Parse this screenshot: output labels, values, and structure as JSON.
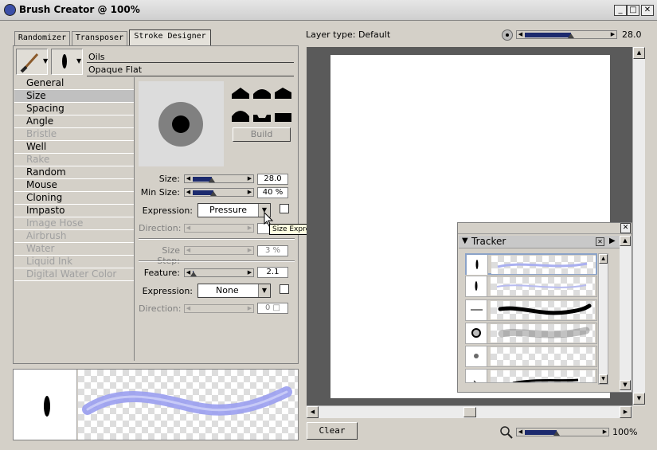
{
  "window": {
    "title": "Brush Creator @ 100%",
    "min": "_",
    "max": "□",
    "close": "✕"
  },
  "tabs": [
    {
      "label": "Randomizer"
    },
    {
      "label": "Transposer"
    },
    {
      "label": "Stroke Designer"
    }
  ],
  "brush": {
    "category": "Oils",
    "variant": "Opaque Flat"
  },
  "menu": [
    {
      "label": "General",
      "disabled": false
    },
    {
      "label": "Size",
      "disabled": false,
      "selected": true
    },
    {
      "label": "Spacing",
      "disabled": false
    },
    {
      "label": "Angle",
      "disabled": false
    },
    {
      "label": "Bristle",
      "disabled": true
    },
    {
      "label": "Well",
      "disabled": false
    },
    {
      "label": "Rake",
      "disabled": true
    },
    {
      "label": "Random",
      "disabled": false
    },
    {
      "label": "Mouse",
      "disabled": false
    },
    {
      "label": "Cloning",
      "disabled": false
    },
    {
      "label": "Impasto",
      "disabled": false
    },
    {
      "label": "Image Hose",
      "disabled": true
    },
    {
      "label": "Airbrush",
      "disabled": true
    },
    {
      "label": "Water",
      "disabled": true
    },
    {
      "label": "Liquid Ink",
      "disabled": true
    },
    {
      "label": "Digital Water Color",
      "disabled": true
    }
  ],
  "size_panel": {
    "build_label": "Build",
    "size_label": "Size:",
    "size_value": "28.0",
    "size_level": 0.37,
    "min_size_label": "Min Size:",
    "min_size_value": "40 %",
    "min_size_level": 0.4,
    "expression_label": "Expression:",
    "expression_value": "Pressure",
    "direction_label": "Direction:",
    "tooltip": "Size Expression",
    "size_step_label": "Size Step:",
    "size_step_value": "3 %",
    "feature_label": "Feature:",
    "feature_value": "2.1",
    "feature_level": 0.02,
    "expression2_label": "Expression:",
    "expression2_value": "None",
    "direction2_label": "Direction:",
    "direction2_value": "0 □"
  },
  "canvas": {
    "layer_type": "Layer type: Default",
    "brush_size": "28.0",
    "brush_level": 0.55,
    "zoom": "100%",
    "zoom_level": 0.42,
    "clear_label": "Clear"
  },
  "tracker": {
    "title": "Tracker",
    "close": "✕"
  },
  "colors": {
    "stroke": "#9a9ff0",
    "menu_selected": "#c0c0c0",
    "slider_fill": "#1c2a6e"
  },
  "icons": [
    "brush-icon",
    "dab-icon",
    "dropdown-arrow-icon",
    "dab-profile-icon",
    "zoom-icon",
    "tracker-menu-icon"
  ]
}
